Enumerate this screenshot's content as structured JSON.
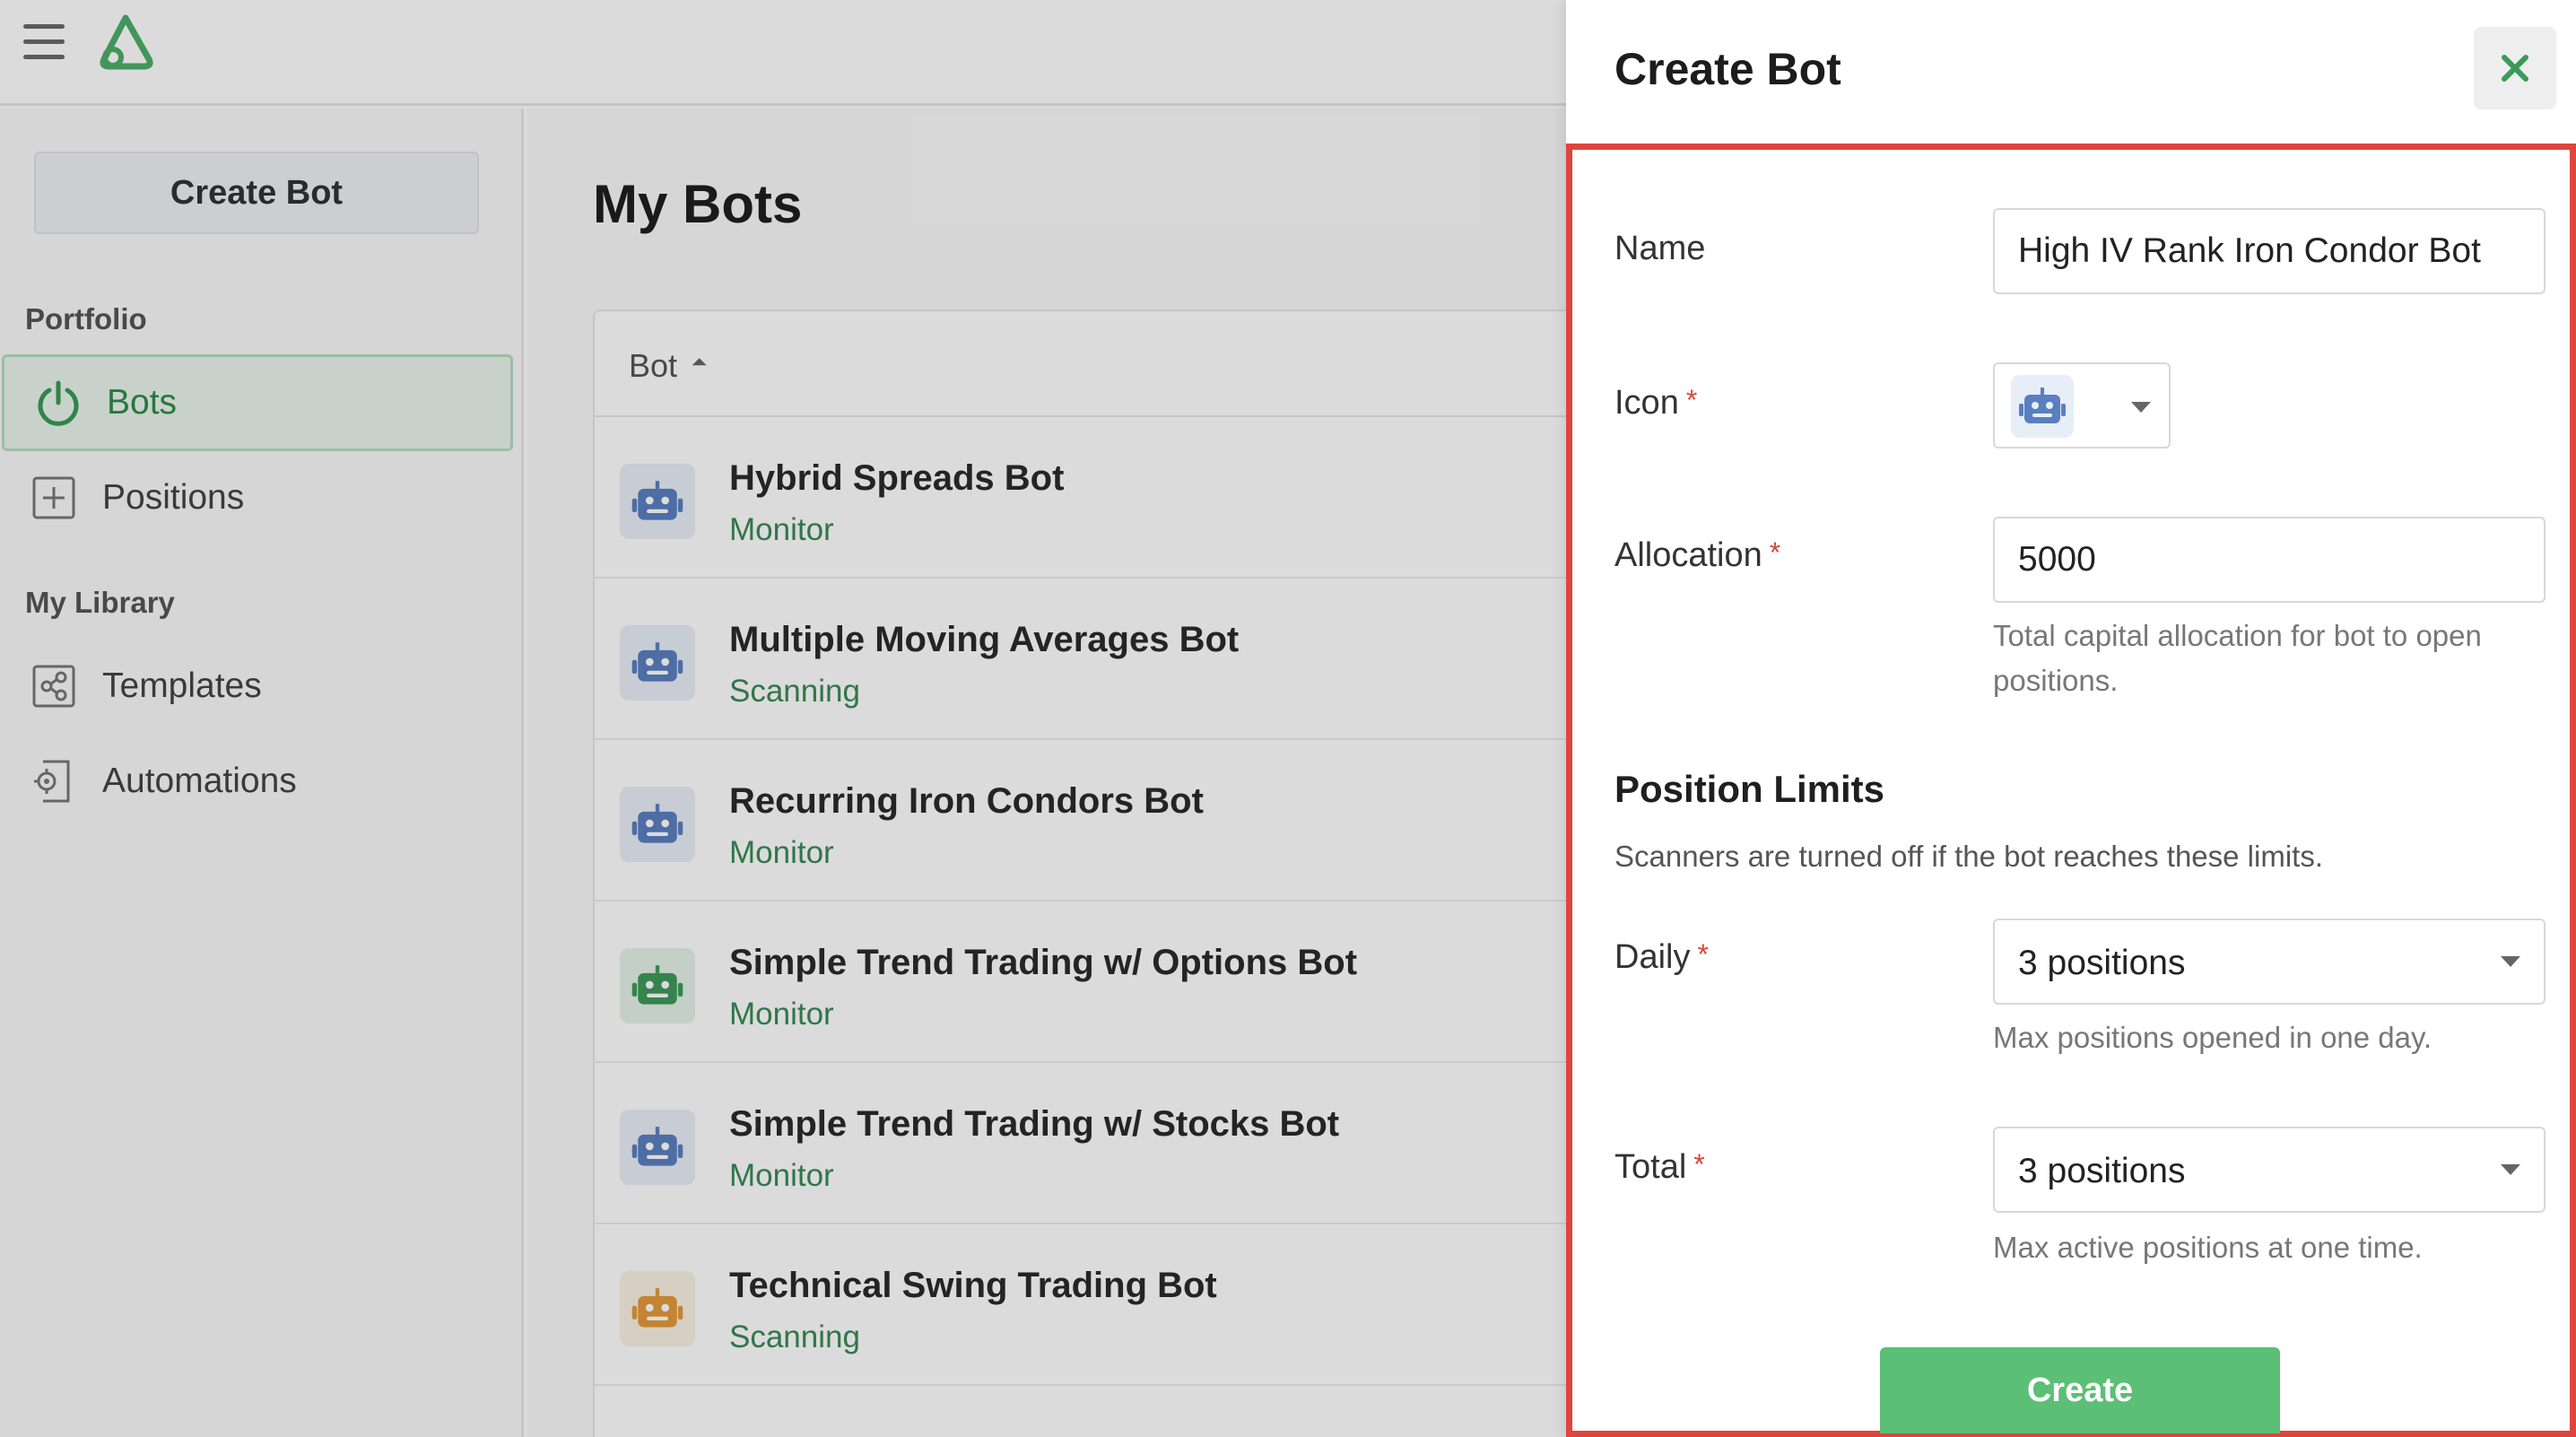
{
  "sidebar": {
    "create_label": "Create Bot",
    "portfolio_section": "Portfolio",
    "library_section": "My Library",
    "items": [
      {
        "label": "Bots",
        "icon": "power-icon",
        "active": true
      },
      {
        "label": "Positions",
        "icon": "plus-square-icon"
      },
      {
        "label": "Templates",
        "icon": "share-icon"
      },
      {
        "label": "Automations",
        "icon": "gear-document-icon"
      }
    ]
  },
  "main": {
    "title": "My Bots",
    "column_header": "Bot",
    "sort_indicator": "⏶",
    "rows": [
      {
        "name": "Hybrid Spreads Bot",
        "status": "Monitor",
        "icon_color": "#5a7fc0"
      },
      {
        "name": "Multiple Moving Averages Bot",
        "status": "Scanning",
        "icon_color": "#5a7fc0"
      },
      {
        "name": "Recurring Iron Condors Bot",
        "status": "Monitor",
        "icon_color": "#5a7fc0"
      },
      {
        "name": "Simple Trend Trading w/ Options Bot",
        "status": "Monitor",
        "icon_color": "#3e9a5a"
      },
      {
        "name": "Simple Trend Trading w/ Stocks Bot",
        "status": "Monitor",
        "icon_color": "#5a7fc0"
      },
      {
        "name": "Technical Swing Trading Bot",
        "status": "Scanning",
        "icon_color": "#e39a3c"
      }
    ]
  },
  "drawer": {
    "title": "Create Bot",
    "close_icon": "close-icon",
    "name_label": "Name",
    "name_value": "High IV Rank Iron Condor Bot",
    "icon_label": "Icon",
    "icon_value": "robot-icon",
    "allocation_label": "Allocation",
    "allocation_value": "5000",
    "allocation_help": "Total capital allocation for bot to open positions.",
    "position_limits_title": "Position Limits",
    "position_limits_desc": "Scanners are turned off if the bot reaches these limits.",
    "daily_label": "Daily",
    "daily_value": "3 positions",
    "daily_help": "Max positions opened in one day.",
    "total_label": "Total",
    "total_value": "3 positions",
    "total_help": "Max active positions at one time.",
    "create_label": "Create",
    "required_mark": "*"
  },
  "colors": {
    "accent": "#5cbf76",
    "highlight": "#e0453d",
    "status_green": "#3a8a55"
  }
}
